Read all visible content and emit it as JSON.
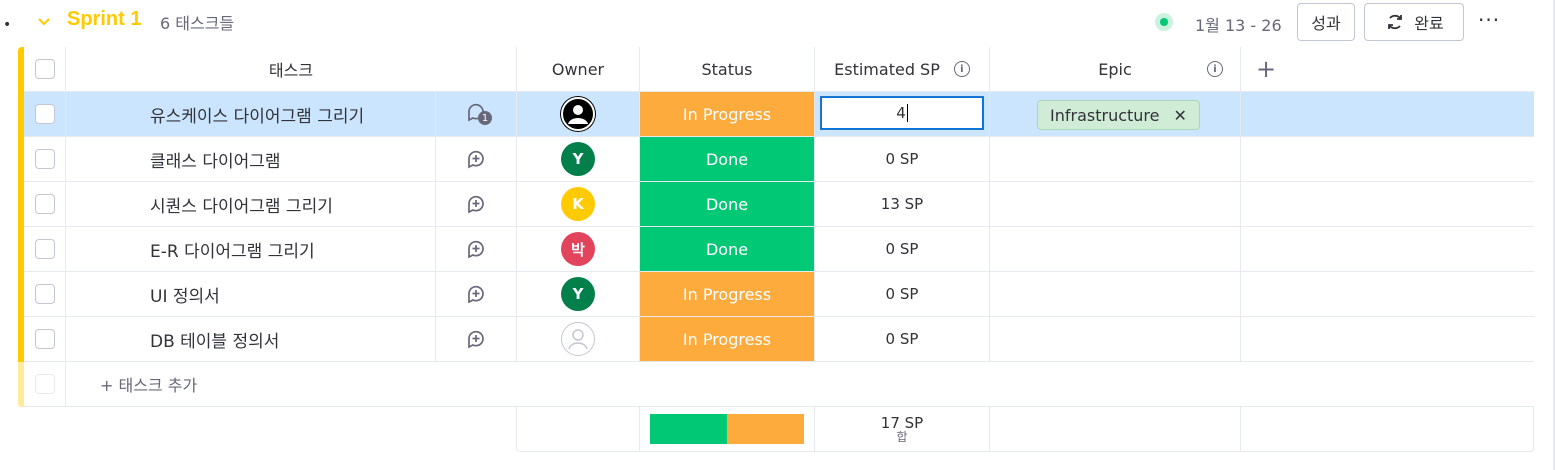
{
  "group": {
    "title": "Sprint 1",
    "count": "6 태스크들",
    "date_range": "1월 13 - 26",
    "buttons": {
      "results": "성과",
      "complete": "완료"
    },
    "more": "···",
    "bullet": "•"
  },
  "columns": {
    "task": "태스크",
    "owner": "Owner",
    "status": "Status",
    "estimated_sp": "Estimated SP",
    "epic": "Epic",
    "add": "+"
  },
  "colors": {
    "group": "#ffcb00",
    "in_progress": "#fdab3d",
    "done": "#00c875",
    "selected_row": "#cce5ff"
  },
  "rows": [
    {
      "name": "유스케이스 다이어그램 그리기",
      "status": "In Progress",
      "sp": "4",
      "epic": "Infrastructure",
      "owner": "user-icon",
      "comments": "1",
      "editing": true
    },
    {
      "name": "클래스 다이어그램",
      "status": "Done",
      "sp": "0 SP",
      "owner": "Y",
      "owner_color": "#037f4c"
    },
    {
      "name": "시퀀스 다이어그램 그리기",
      "status": "Done",
      "sp": "13 SP",
      "owner": "K",
      "owner_color": "#ffcb00"
    },
    {
      "name": "E-R 다이어그램 그리기",
      "status": "Done",
      "sp": "0 SP",
      "owner": "박",
      "owner_color": "#e2445c"
    },
    {
      "name": "UI 정의서",
      "status": "In Progress",
      "sp": "0 SP",
      "owner": "Y",
      "owner_color": "#037f4c"
    },
    {
      "name": "DB 테이블 정의서",
      "status": "In Progress",
      "sp": "0 SP",
      "owner": "empty-person-icon"
    }
  ],
  "add_task": "+ 태스크 추가",
  "summary": {
    "sp_total": "17 SP",
    "sp_label": "합",
    "done_ratio": 0.5,
    "in_progress_ratio": 0.5
  }
}
